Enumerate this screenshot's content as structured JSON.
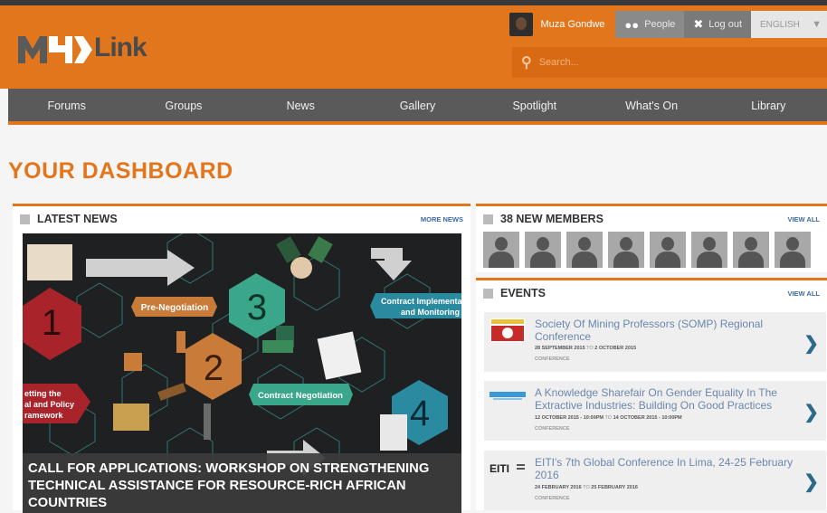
{
  "header": {
    "logo_text": "Link",
    "user_name": "Muza Gondwe",
    "people_label": "People",
    "logout_label": "Log out",
    "language": "ENGLISH",
    "search_placeholder": "Search..."
  },
  "nav": [
    "Forums",
    "Groups",
    "News",
    "Gallery",
    "Spotlight",
    "What's On",
    "Library"
  ],
  "page_title": "YOUR DASHBOARD",
  "latest_news": {
    "title": "LATEST NEWS",
    "more": "MORE NEWS",
    "headline": "CALL FOR APPLICATIONS: WORKSHOP ON STRENGTHENING TECHNICAL ASSISTANCE FOR RESOURCE-RICH AFRICAN COUNTRIES",
    "graphic": {
      "label_preneg": "Pre-Negotiation",
      "label_contract": "Contract Negotiation",
      "label_impl_1": "Contract Implementa",
      "label_impl_2": "and Monitoring",
      "label_frame_1": "etting the",
      "label_frame_2": "al and Policy",
      "label_frame_3": "ramework",
      "n1": "1",
      "n2": "2",
      "n3": "3",
      "n4": "4"
    }
  },
  "members": {
    "title": "38 NEW MEMBERS",
    "more": "VIEW ALL",
    "count": 8
  },
  "events": {
    "title": "EVENTS",
    "more": "VIEW ALL",
    "items": [
      {
        "title": "Society Of Mining Professors (SOMP) Regional Conference",
        "start": "28 SEPTEMBER 2015",
        "to": "TO",
        "end": "2 OCTOBER 2015",
        "type": "CONFERENCE"
      },
      {
        "title": "A Knowledge Sharefair On Gender Equality In The Extractive Industries: Building On Good Practices",
        "start": "12 OCTOBER 2015 - 10:00PM",
        "to": "TO",
        "end": "14 OCTOBER 2015 - 10:00PM",
        "type": "CONFERENCE"
      },
      {
        "title": "EITI's 7th Global Conference In Lima, 24-25 February 2016",
        "start": "24 FEBRUARY 2016",
        "to": "TO",
        "end": "25 FEBRUARY 2016",
        "type": "CONFERENCE",
        "logo_text": "EITI"
      }
    ]
  },
  "colors": {
    "brand": "#e2761d",
    "nav": "#5a5a5a",
    "link": "#6b86ad"
  }
}
